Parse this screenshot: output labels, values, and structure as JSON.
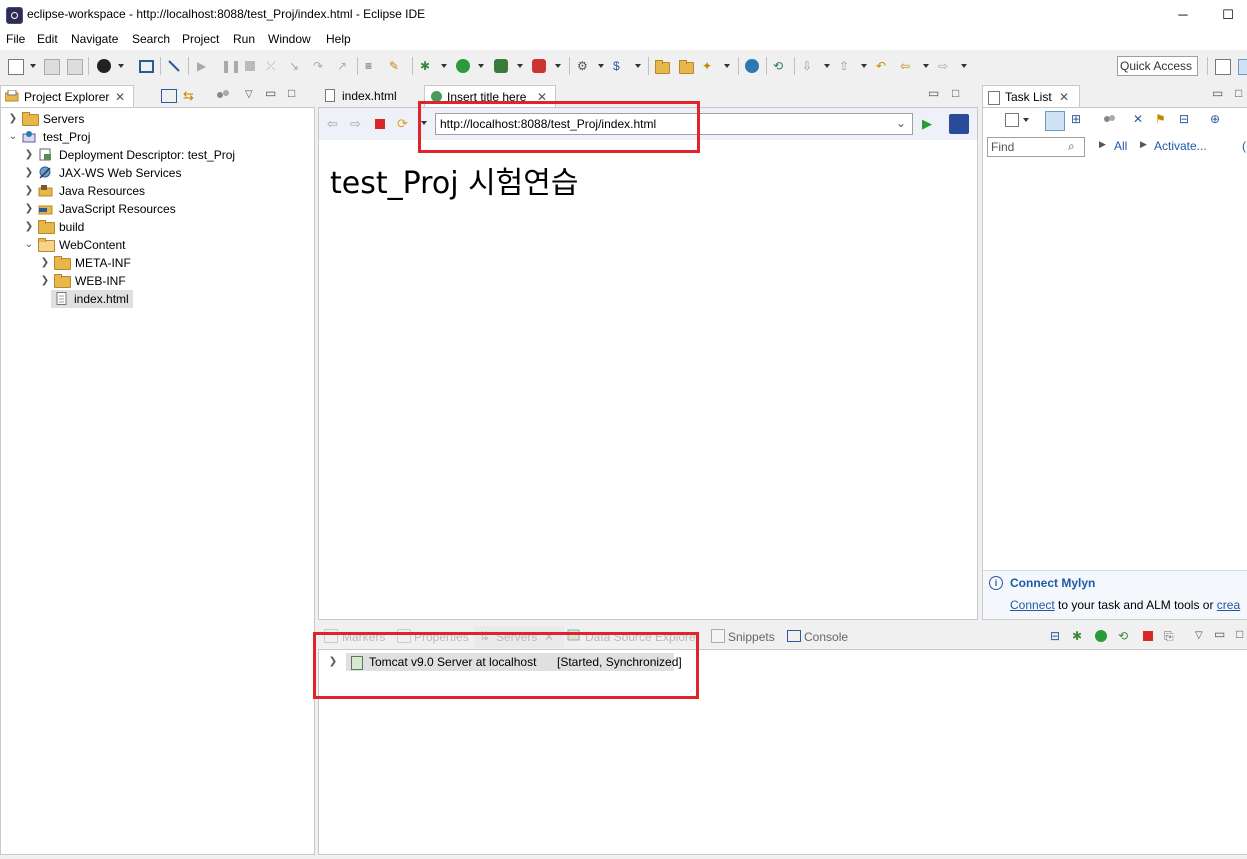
{
  "window": {
    "title": "eclipse-workspace - http://localhost:8088/test_Proj/index.html - Eclipse IDE",
    "minimize": "─",
    "maximize": "☐"
  },
  "menu": [
    "File",
    "Edit",
    "Navigate",
    "Search",
    "Project",
    "Run",
    "Window",
    "Help"
  ],
  "toolbar": {
    "quick_access": "Quick Access"
  },
  "project_explorer": {
    "tab_label": "Project Explorer",
    "items": [
      {
        "label": "Servers"
      },
      {
        "label": "test_Proj"
      },
      {
        "label": "Deployment Descriptor: test_Proj"
      },
      {
        "label": "JAX-WS Web Services"
      },
      {
        "label": "Java Resources"
      },
      {
        "label": "JavaScript Resources"
      },
      {
        "label": "build"
      },
      {
        "label": "WebContent"
      },
      {
        "label": "META-INF"
      },
      {
        "label": "WEB-INF"
      },
      {
        "label": "index.html"
      }
    ]
  },
  "editor": {
    "tabs": [
      {
        "label": "index.html"
      },
      {
        "label": "Insert title here"
      }
    ],
    "url": "http://localhost:8088/test_Proj/index.html",
    "page_heading": "test_Proj 시험연습"
  },
  "task_list": {
    "tab_label": "Task List",
    "find_placeholder": "Find",
    "filter_all": "All",
    "filter_activate": "Activate...",
    "connect_title": "Connect Mylyn",
    "connect_link": "Connect",
    "connect_text": " to your task and ALM tools or ",
    "create_link": "crea"
  },
  "bottom_panel": {
    "tabs": [
      "Markers",
      "Properties",
      "Servers",
      "Data Source Explorer",
      "Snippets",
      "Console"
    ],
    "server_row": "Tomcat v9.0 Server at localhost",
    "server_status": "[Started, Synchronized]"
  },
  "colors": {
    "highlight_red": "#e0242c",
    "link_blue": "#1e5aa8",
    "selection_gray": "#e0e0e0"
  }
}
